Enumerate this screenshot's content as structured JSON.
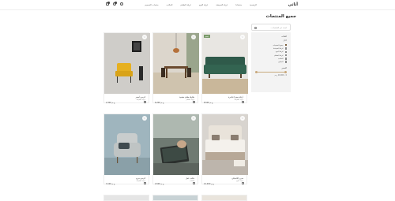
{
  "header": {
    "logo": "أثاثي",
    "nav": [
      "الرئيسية",
      "منتجاتنا",
      "غرفة المعيشة",
      "غرفة النوم",
      "غرفة الطعام",
      "المكتب",
      "منتجات التصميم"
    ],
    "cart_count": "",
    "wishlist_count": ""
  },
  "page": {
    "title": "جميع المنتجات"
  },
  "search": {
    "placeholder": "ابحث عن المنتجات..."
  },
  "filter": {
    "title": "الفئات",
    "subtitle": "الكل",
    "items": [
      {
        "label": "جميع المنتجات",
        "checked": true
      },
      {
        "label": "غرفة المعيشة",
        "checked": false
      },
      {
        "label": "غرفة النوم",
        "checked": false
      },
      {
        "label": "غرفة الطعام",
        "checked": false
      },
      {
        "label": "المكتب",
        "checked": false
      },
      {
        "label": "الديكور",
        "checked": false
      }
    ],
    "price_title": "السعر",
    "price_range": "0 - 10,000 ج.م"
  },
  "products": [
    {
      "name": "أريكة خضراء فاخرة",
      "category": "غرفة المعيشة",
      "price": "8,500 ج.م",
      "sale": "خصم"
    },
    {
      "name": "طاولة طعام خشبية",
      "category": "غرفة الطعام",
      "price": "6,200 ج.م",
      "sale": ""
    },
    {
      "name": "كرسي أصفر",
      "category": "غرفة المعيشة",
      "price": "2,300 ج.م",
      "sale": ""
    },
    {
      "name": "سرير كلاسيكي",
      "category": "غرفة النوم",
      "price": "12,000 ج.م",
      "sale": ""
    },
    {
      "name": "مكتب عمل",
      "category": "المكتب",
      "price": "4,500 ج.م",
      "sale": ""
    },
    {
      "name": "كرسي مريح",
      "category": "غرفة المعيشة",
      "price": "3,100 ج.م",
      "sale": ""
    }
  ],
  "colors": {
    "accent": "#7a5c3b",
    "filter_bg": "#f3f3f3",
    "sale_badge": "#7a9a6a"
  }
}
